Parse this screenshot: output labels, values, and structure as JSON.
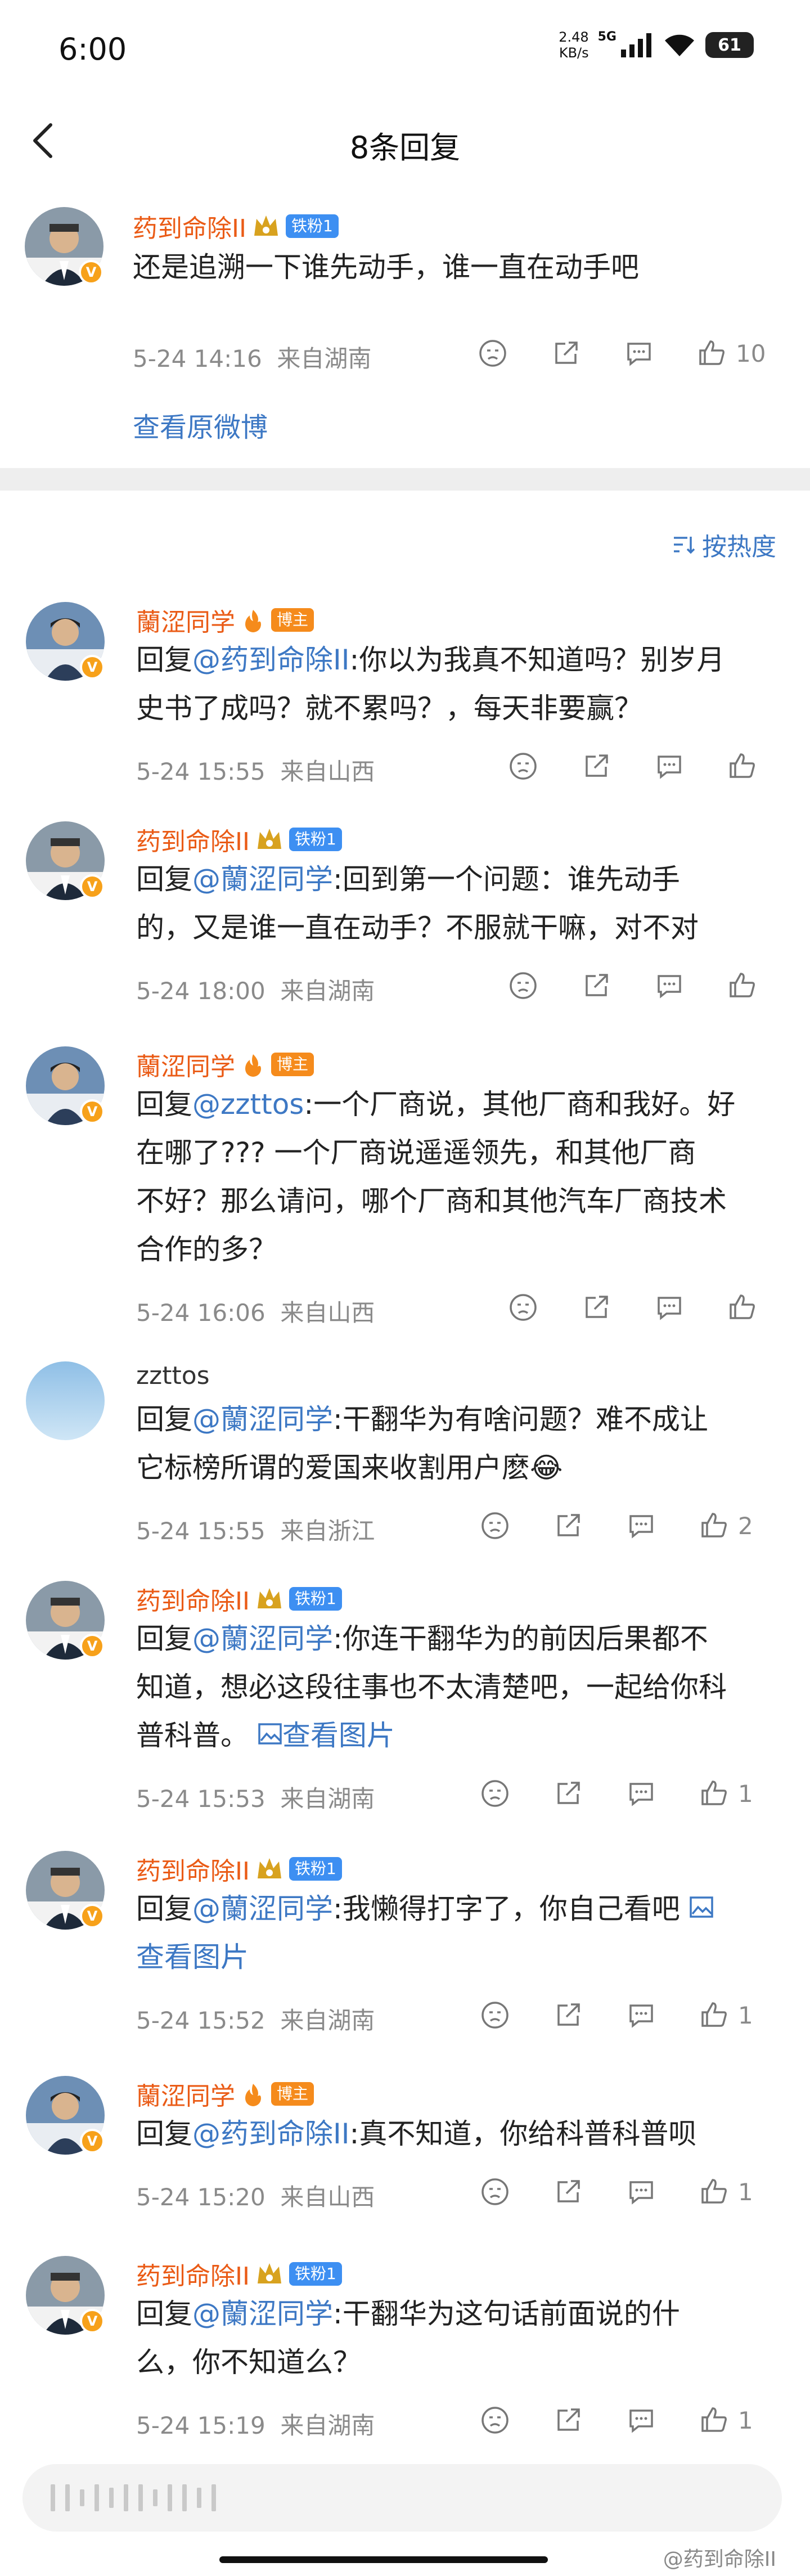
{
  "status": {
    "time": "6:00",
    "speed": "2.48",
    "speed_unit": "KB/s",
    "network": "5G",
    "battery": "61"
  },
  "header": {
    "title": "8条回复",
    "back_icon": "chevron-left-icon"
  },
  "original": {
    "user": "药到命除II",
    "fan_badge": "铁粉1",
    "text": "还是追溯一下谁先动手，谁一直在动手吧",
    "date": "5-24 14:16",
    "location": "来自湖南",
    "likes": "10",
    "view_original": "查看原微博"
  },
  "sort_label": "按热度",
  "replies": [
    {
      "user": "蘭涩同学",
      "badge_type": "host",
      "badge": "博主",
      "prefix": "回复",
      "mention": "@药到命除II",
      "line1": ":你以为我真不知道吗？别岁月",
      "line2": "史书了成吗？就不累吗？，每天非要赢？",
      "line3": "",
      "line4": "",
      "img_link": "",
      "date": "5-24 15:55",
      "location": "来自山西",
      "likes": ""
    },
    {
      "user": "药到命除II",
      "badge_type": "fan",
      "badge": "铁粉1",
      "prefix": "回复",
      "mention": "@蘭涩同学",
      "line1": ":回到第一个问题：谁先动手",
      "line2": "的，又是谁一直在动手？不服就干嘛，对不对",
      "line3": "",
      "line4": "",
      "img_link": "",
      "date": "5-24 18:00",
      "location": "来自湖南",
      "likes": ""
    },
    {
      "user": "蘭涩同学",
      "badge_type": "host",
      "badge": "博主",
      "prefix": "回复",
      "mention": "@zzttos",
      "line1": ":一个厂商说，其他厂商和我好。好",
      "line2": "在哪了??? 一个厂商说遥遥领先，和其他厂商",
      "line3": "不好？那么请问，哪个厂商和其他汽车厂商技术",
      "line4": "合作的多？",
      "img_link": "",
      "date": "5-24 16:06",
      "location": "来自山西",
      "likes": ""
    },
    {
      "user": "zzttos",
      "badge_type": "none",
      "badge": "",
      "prefix": "回复",
      "mention": "@蘭涩同学",
      "line1": ":干翻华为有啥问题？难不成让",
      "line2": "它标榜所谓的爱国来收割用户麽😂",
      "line3": "",
      "line4": "",
      "img_link": "",
      "date": "5-24 15:55",
      "location": "来自浙江",
      "likes": "2"
    },
    {
      "user": "药到命除II",
      "badge_type": "fan",
      "badge": "铁粉1",
      "prefix": "回复",
      "mention": "@蘭涩同学",
      "line1": ":你连干翻华为的前因后果都不",
      "line2": "知道，想必这段往事也不太清楚吧，一起给你科",
      "line3": "普科普。",
      "line4": "",
      "img_link": "查看图片",
      "date": "5-24 15:53",
      "location": "来自湖南",
      "likes": "1"
    },
    {
      "user": "药到命除II",
      "badge_type": "fan",
      "badge": "铁粉1",
      "prefix": "回复",
      "mention": "@蘭涩同学",
      "line1": ":我懒得打字了，你自己看吧",
      "line2": "",
      "line3": "",
      "line4": "",
      "img_link": "查看图片",
      "date": "5-24 15:52",
      "location": "来自湖南",
      "likes": "1"
    },
    {
      "user": "蘭涩同学",
      "badge_type": "host",
      "badge": "博主",
      "prefix": "回复",
      "mention": "@药到命除II",
      "line1": ":真不知道，你给科普科普呗",
      "line2": "",
      "line3": "",
      "line4": "",
      "img_link": "",
      "date": "5-24 15:20",
      "location": "来自山西",
      "likes": "1"
    },
    {
      "user": "药到命除II",
      "badge_type": "fan",
      "badge": "铁粉1",
      "prefix": "回复",
      "mention": "@蘭涩同学",
      "line1": ":干翻华为这句话前面说的什",
      "line2": "么，你不知道么？",
      "line3": "",
      "line4": "",
      "img_link": "",
      "date": "5-24 15:19",
      "location": "来自湖南",
      "likes": "1"
    }
  ],
  "watermark": "@药到命除II",
  "colors": {
    "accent_blue": "#3d78c4",
    "username_orange": "#ea5b16",
    "fan_badge": "#3d8ff2",
    "host_badge": "#f58b1c"
  }
}
